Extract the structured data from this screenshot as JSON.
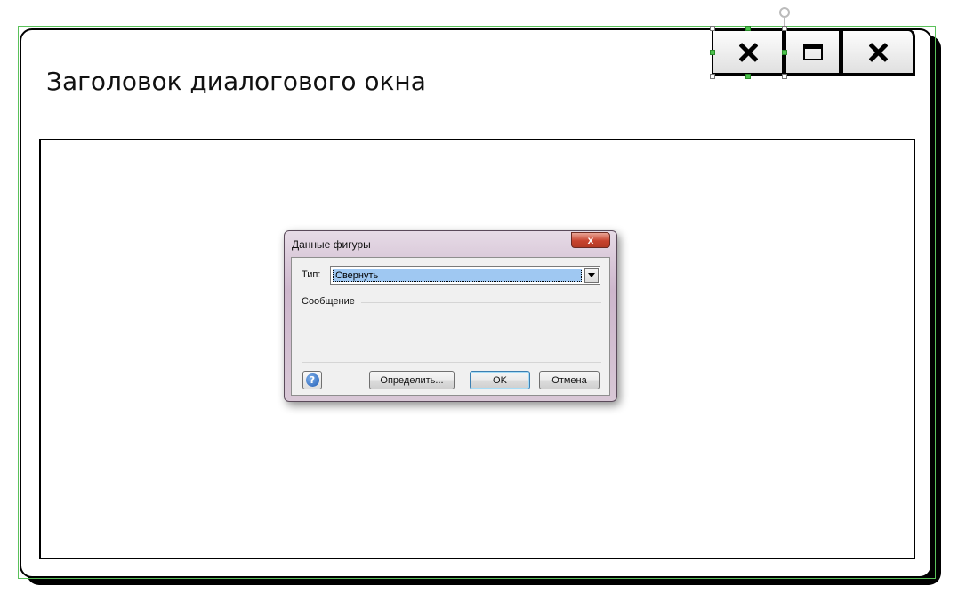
{
  "window": {
    "title": "Заголовок диалогового окна",
    "buttons": {
      "first_icon": "close-icon",
      "maximize_icon": "maximize-icon",
      "close_icon": "close-icon"
    }
  },
  "dialog": {
    "title": "Данные фигуры",
    "type_label": "Тип:",
    "type_value": "Свернуть",
    "message_label": "Сообщение",
    "buttons": {
      "define": "Определить...",
      "ok": "OK",
      "cancel": "Отмена"
    },
    "help_glyph": "?",
    "close_glyph": "x"
  },
  "colors": {
    "selection": "#5ac15a",
    "combo_highlight": "#9fc8f2",
    "dialog_close": "#c7432e"
  }
}
